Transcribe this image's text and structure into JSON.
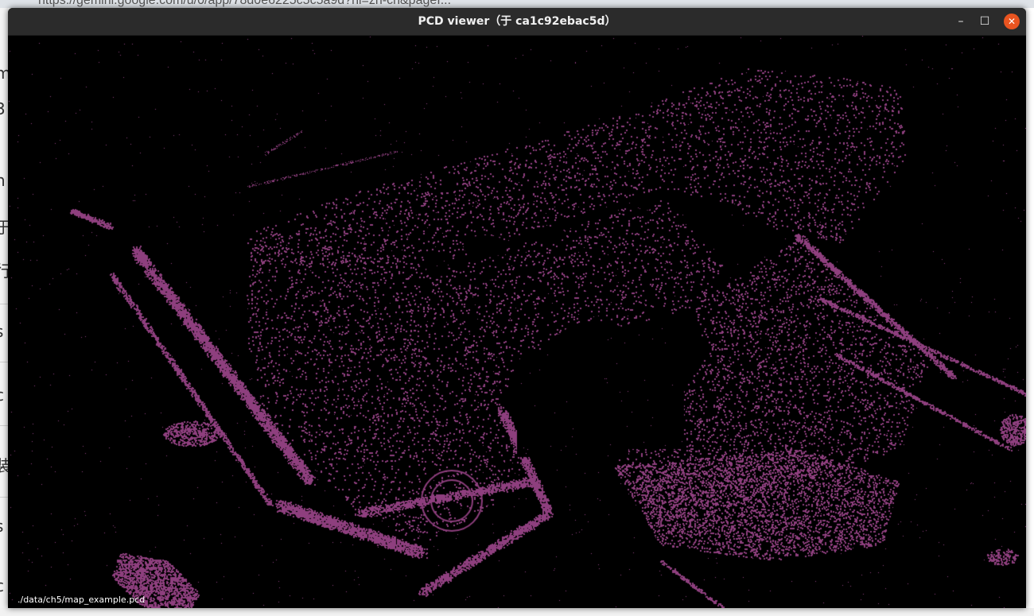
{
  "background": {
    "url_fragment": "https://gemini.google.com/u/0/app/78d0e6225c5c5a9d?hl=zh-cn&pageI..."
  },
  "window": {
    "title": "PCD viewer（于 ca1c92ebac5d）",
    "minimize_icon": "minimize-icon",
    "maximize_icon": "maximize-icon",
    "close_icon": "close-icon",
    "minimize_glyph": "–",
    "maximize_glyph": "☐",
    "close_glyph": "✕"
  },
  "viewer": {
    "point_color": "#8e3f7e",
    "background_color": "#000000",
    "file_path": "./data/ch5/map_example.pcd"
  }
}
